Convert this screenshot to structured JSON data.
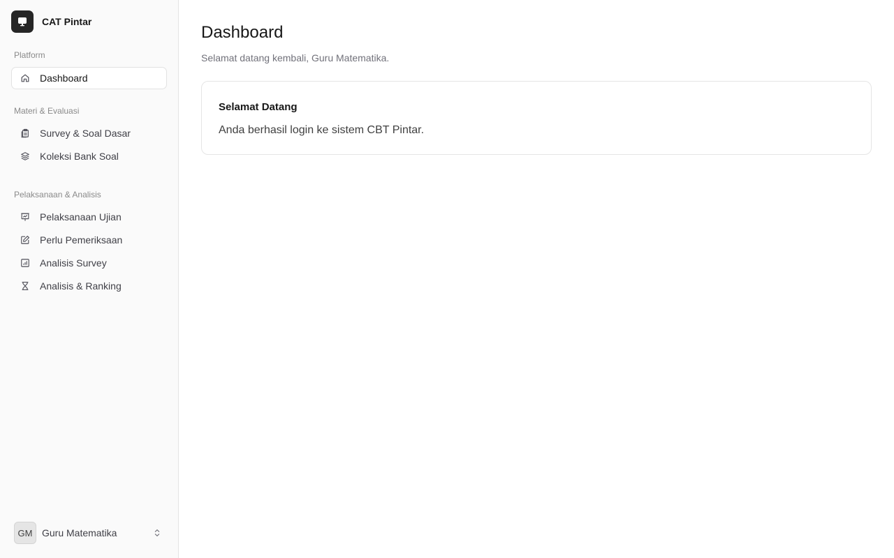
{
  "app": {
    "name": "CAT Pintar"
  },
  "sidebar": {
    "groups": [
      {
        "label": "Platform",
        "items": [
          {
            "label": "Dashboard",
            "icon": "home-icon"
          }
        ]
      },
      {
        "label": "Materi & Evaluasi",
        "items": [
          {
            "label": "Survey & Soal Dasar",
            "icon": "clipboard-icon"
          },
          {
            "label": "Koleksi Bank Soal",
            "icon": "layers-icon"
          }
        ]
      },
      {
        "label": "Pelaksanaan & Analisis",
        "items": [
          {
            "label": "Pelaksanaan Ujian",
            "icon": "presentation-icon"
          },
          {
            "label": "Perlu Pemeriksaan",
            "icon": "pencil-icon"
          },
          {
            "label": "Analisis Survey",
            "icon": "bar-chart-icon"
          },
          {
            "label": "Analisis & Ranking",
            "icon": "hourglass-icon"
          }
        ]
      }
    ],
    "active_item": "Dashboard"
  },
  "user": {
    "initials": "GM",
    "name": "Guru Matematika"
  },
  "main": {
    "title": "Dashboard",
    "subtitle": "Selamat datang kembali, Guru Matematika.",
    "card": {
      "title": "Selamat Datang",
      "text": "Anda berhasil login ke sistem CBT Pintar."
    }
  },
  "colors": {
    "sidebar_bg": "#fafafa",
    "border": "#e5e5e5",
    "logo_bg": "#262626",
    "text_primary": "#171717",
    "text_muted": "#71717a"
  }
}
